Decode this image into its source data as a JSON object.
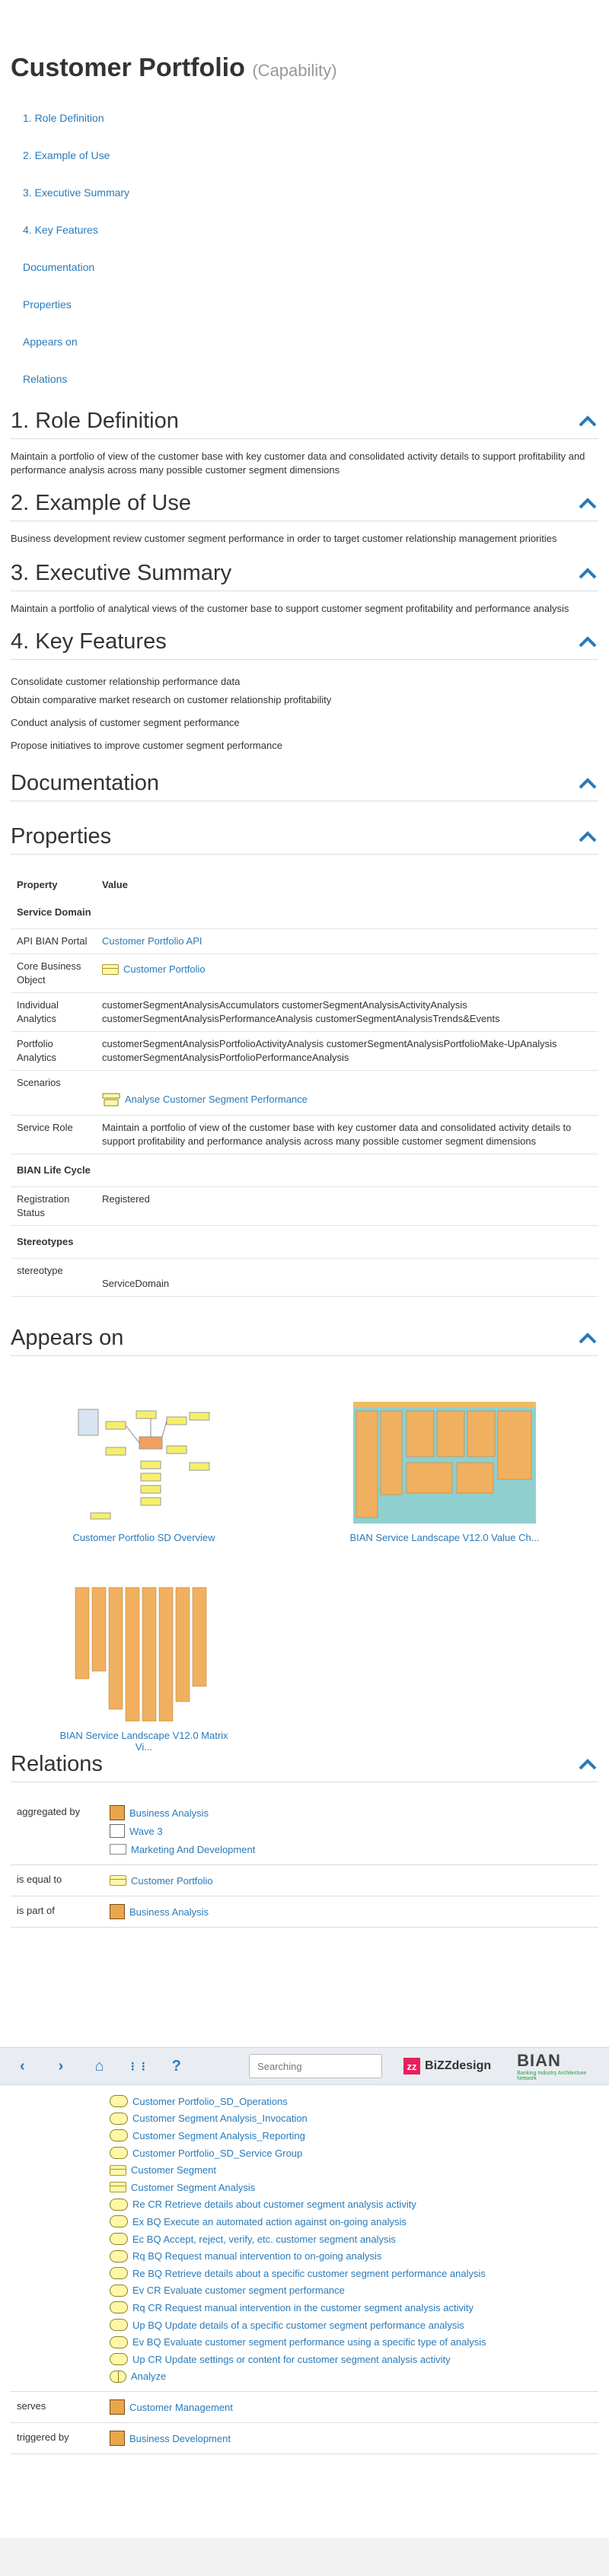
{
  "page": {
    "title": "Customer Portfolio",
    "title_suffix": "(Capability)"
  },
  "toc": [
    "1. Role Definition",
    "2. Example of Use",
    "3. Executive Summary",
    "4. Key Features",
    "Documentation",
    "Properties",
    "Appears on",
    "Relations"
  ],
  "sections": {
    "role_definition": {
      "heading": "1. Role Definition",
      "text": "Maintain a portfolio of view of the customer base with key customer data and consolidated activity details to support profitability and performance analysis across many possible customer segment dimensions"
    },
    "example_of_use": {
      "heading": "2. Example of Use",
      "text": "Business development review customer segment performance in order to target customer relationship management priorities"
    },
    "executive_summary": {
      "heading": "3. Executive Summary",
      "text": "Maintain a portfolio of analytical views of the customer base to support customer segment profitability and performance analysis"
    },
    "key_features": {
      "heading": "4. Key Features",
      "items": [
        "Consolidate customer relationship performance data",
        "Obtain comparative market research on customer relationship profitability",
        "Conduct analysis of customer segment performance",
        "Propose initiatives to improve customer segment performance"
      ]
    },
    "documentation": {
      "heading": "Documentation"
    },
    "properties": {
      "heading": "Properties",
      "col_property": "Property",
      "col_value": "Value",
      "group_service_domain": "Service Domain",
      "api_label": "API BIAN Portal",
      "api_value": "Customer Portfolio API",
      "cbo_label": "Core Business Object",
      "cbo_value": "Customer Portfolio",
      "ia_label": "Individual Analytics",
      "ia_value": "customerSegmentAnalysisAccumulators customerSegmentAnalysisActivityAnalysis customerSegmentAnalysisPerformanceAnalysis customerSegmentAnalysisTrends&Events",
      "pa_label": "Portfolio Analytics",
      "pa_value": "customerSegmentAnalysisPortfolioActivityAnalysis customerSegmentAnalysisPortfolioMake-UpAnalysis customerSegmentAnalysisPortfolioPerformanceAnalysis",
      "sc_label": "Scenarios",
      "sc_value": "Analyse Customer Segment Performance",
      "sr_label": "Service Role",
      "sr_value": "Maintain a portfolio of view of the customer base with key customer data and consolidated activity details to support profitability and performance analysis across many possible customer segment dimensions",
      "group_lifecycle": "BIAN Life Cycle",
      "rs_label": "Registration Status",
      "rs_value": "Registered",
      "group_stereotypes": "Stereotypes",
      "st_label": "stereotype",
      "st_value": "ServiceDomain"
    },
    "appears_on": {
      "heading": "Appears on",
      "items": [
        "Customer Portfolio SD Overview",
        "BIAN Service Landscape V12.0 Value Ch...",
        "BIAN Service Landscape V12.0 Matrix Vi..."
      ]
    },
    "relations": {
      "heading": "Relations",
      "aggregated_by_label": "aggregated by",
      "aggregated_by": [
        "Business Analysis",
        "Wave 3",
        "Marketing And Development"
      ],
      "is_equal_to_label": "is equal to",
      "is_equal_to": [
        "Customer Portfolio"
      ],
      "is_part_of_label": "is part of",
      "is_part_of": [
        "Business Analysis"
      ],
      "composed_of": [
        "Customer Portfolio_SD_Operations",
        "Customer Segment Analysis_Invocation",
        "Customer Segment Analysis_Reporting",
        "Customer Portfolio_SD_Service Group",
        "Customer Segment",
        "Customer Segment Analysis",
        "Re CR Retrieve details about customer segment analysis activity",
        "Ex BQ Execute an automated action against on-going analysis",
        "Ec BQ Accept, reject, verify, etc. customer segment analysis",
        "Rq BQ Request manual intervention to on-going analysis",
        "Re BQ Retrieve details about a specific customer segment performance analysis",
        "Ev CR Evaluate customer segment performance",
        "Rq CR Request manual intervention in the customer segment analysis activity",
        "Up BQ Update details of a specific customer segment performance analysis",
        "Ev BQ Evaluate customer segment performance using a specific type of analysis",
        "Up CR Update settings or content for customer segment analysis activity",
        "Analyze"
      ],
      "serves_label": "serves",
      "serves": [
        "Customer Management"
      ],
      "triggered_by_label": "triggered by",
      "triggered_by": [
        "Business Development"
      ]
    }
  },
  "toolbar": {
    "back": "‹",
    "forward": "›",
    "home": "⌂",
    "apps": "⋮⋮",
    "help": "?",
    "search_placeholder": "Searching",
    "bizzdesign": "BiZZdesign",
    "bizz_mark": "zz",
    "bian": "BIAN",
    "bian_sub": "Banking Industry Architecture Network"
  },
  "colors": {
    "link": "#2a7ab9",
    "accent": "#2a7ab9",
    "bizz": "#e8205a"
  }
}
